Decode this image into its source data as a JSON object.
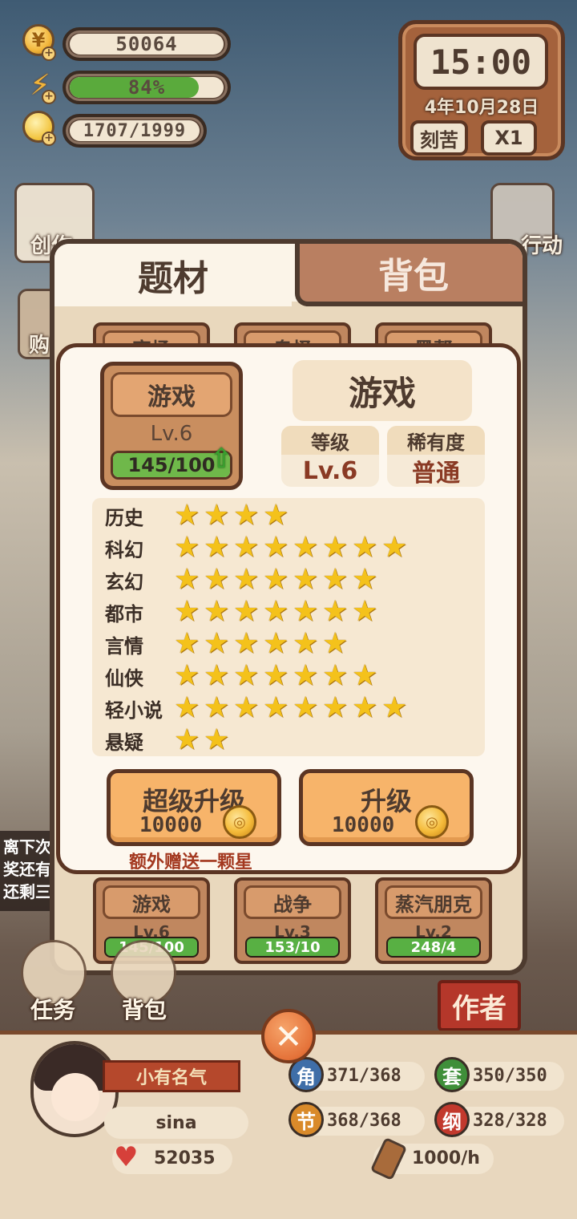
{
  "hud": {
    "coins": "50064",
    "energy": "84%",
    "energy_fill": 0.84,
    "ideas": "1707/1999"
  },
  "clock": {
    "time": "15:00",
    "date": "4年10月28日",
    "mode_label": "刻苦",
    "speed_label": "X1"
  },
  "side_buttons": {
    "left_top": "创作",
    "left_mid": "购",
    "right_top": "行动"
  },
  "left_note": [
    "离下次",
    "奖还有",
    "还剩三"
  ],
  "tabs": {
    "active": "题材",
    "inactive": "背包"
  },
  "genre_cards_top": [
    "官场",
    "鬼怪",
    "黑帮"
  ],
  "genre_cards_bottom": [
    {
      "name": "游戏",
      "level": "Lv.6",
      "progress": "145/100",
      "fill": 1.0
    },
    {
      "name": "战争",
      "level": "Lv.3",
      "progress": "153/10",
      "fill": 1.0
    },
    {
      "name": "蒸汽朋克",
      "level": "Lv.2",
      "progress": "248/4",
      "fill": 1.0
    }
  ],
  "detail": {
    "card_name": "游戏",
    "card_level": "Lv.6",
    "card_progress": "145/100",
    "card_fill": 1.0,
    "title": "游戏",
    "level_header": "等级",
    "level_value": "Lv.6",
    "rarity_header": "稀有度",
    "rarity_value": "普通",
    "affinities": [
      {
        "genre": "历史",
        "stars": 4
      },
      {
        "genre": "科幻",
        "stars": 8
      },
      {
        "genre": "玄幻",
        "stars": 7
      },
      {
        "genre": "都市",
        "stars": 7
      },
      {
        "genre": "言情",
        "stars": 6
      },
      {
        "genre": "仙侠",
        "stars": 7
      },
      {
        "genre": "轻小说",
        "stars": 8
      },
      {
        "genre": "悬疑",
        "stars": 2
      }
    ],
    "super_upgrade_label": "超级升级",
    "super_upgrade_cost": "10000",
    "upgrade_label": "升级",
    "upgrade_cost": "10000",
    "bonus_note": "额外赠送一颗星"
  },
  "nav": {
    "tasks": "任务",
    "bag": "背包",
    "author": "作者"
  },
  "player": {
    "rank": "小有名气",
    "name": "sina",
    "likes": "52035",
    "stats": [
      {
        "badge": "角",
        "value": "371/368",
        "color": "#3f6ea8"
      },
      {
        "badge": "套",
        "value": "350/350",
        "color": "#3f8f3a"
      },
      {
        "badge": "节",
        "value": "368/368",
        "color": "#d98a2a"
      },
      {
        "badge": "纲",
        "value": "328/328",
        "color": "#c2392d"
      }
    ],
    "rate": "1000/h"
  }
}
